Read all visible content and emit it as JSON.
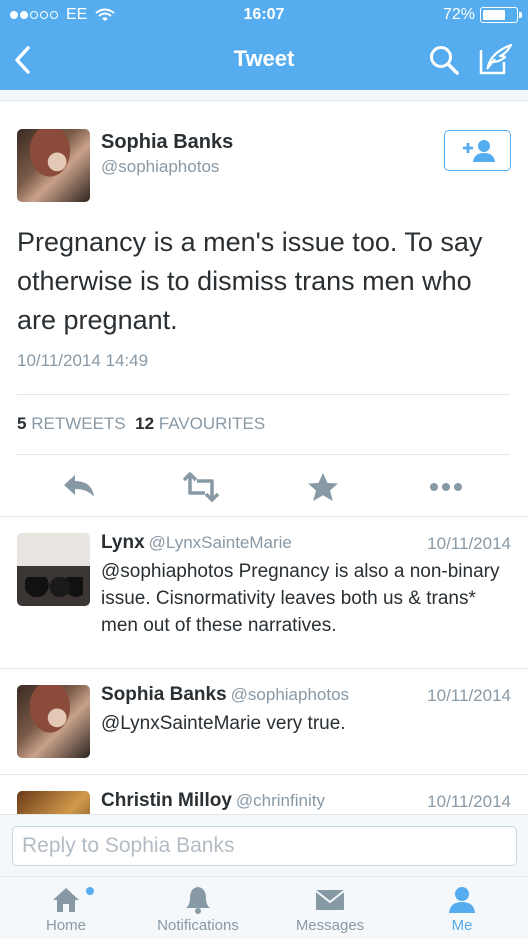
{
  "status": {
    "carrier": "EE",
    "time": "16:07",
    "battery": "72%",
    "battery_level": 0.72
  },
  "nav": {
    "title": "Tweet"
  },
  "tweet": {
    "author_name": "Sophia Banks",
    "author_handle": "@sophiaphotos",
    "text": "Pregnancy is a men's issue too. To say otherwise is to dismiss trans men who are pregnant.",
    "date": "10/11/2014 14:49",
    "retweets_count": "5",
    "retweets_label": "RETWEETS",
    "favourites_count": "12",
    "favourites_label": "FAVOURITES"
  },
  "replies": [
    {
      "name": "Lynx",
      "handle": "@LynxSainteMarie",
      "date": "10/11/2014",
      "text": "@sophiaphotos Pregnancy is also a non-binary issue. Cisnormativity leaves both us & trans* men out of these narratives."
    },
    {
      "name": "Sophia Banks",
      "handle": "@sophiaphotos",
      "date": "10/11/2014",
      "text": "@LynxSainteMarie very true."
    },
    {
      "name": "Christin Milloy",
      "handle": "@chrinfinity",
      "date": "10/11/2014",
      "text": ""
    }
  ],
  "reply_box": {
    "placeholder": "Reply to Sophia Banks"
  },
  "tabs": [
    {
      "label": "Home"
    },
    {
      "label": "Notifications"
    },
    {
      "label": "Messages"
    },
    {
      "label": "Me"
    }
  ],
  "colors": {
    "accent": "#55acee",
    "text": "#292f33",
    "muted": "#8899a6"
  }
}
